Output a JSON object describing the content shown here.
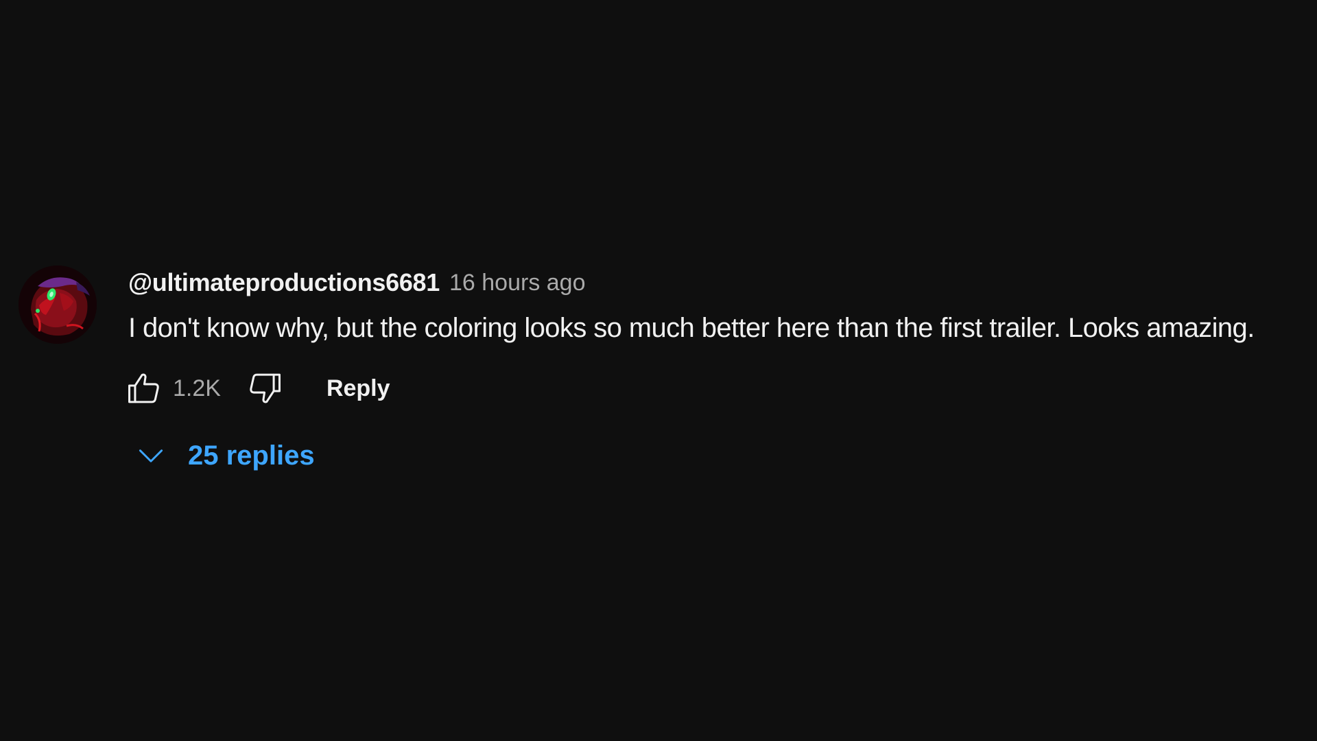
{
  "comment": {
    "author": "@ultimateproductions6681",
    "timestamp": "16 hours ago",
    "text": "I don't know why, but the coloring looks so much better here than the first trailer. Looks amazing.",
    "like_count": "1.2K",
    "reply_label": "Reply",
    "replies_label": "25 replies"
  },
  "icons": {
    "like": "thumbs-up-icon",
    "dislike": "thumbs-down-icon",
    "expand": "chevron-down-icon"
  },
  "colors": {
    "background": "#0f0f0f",
    "text_primary": "#f1f1f1",
    "text_secondary": "#aaaaaa",
    "link_blue": "#3ea6ff"
  }
}
